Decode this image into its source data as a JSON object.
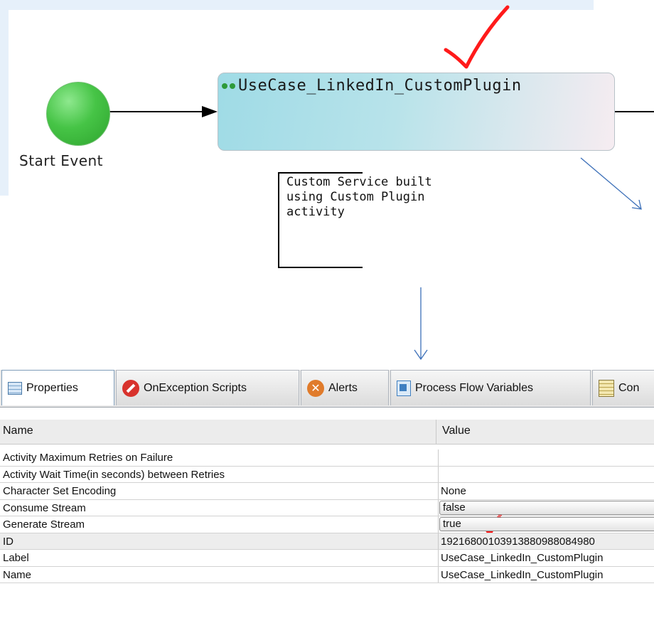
{
  "diagram": {
    "start_event_label": "Start Event",
    "task_title": "UseCase_LinkedIn_CustomPlugin",
    "annotation_lines": [
      "Custom Service built",
      "using Custom Plugin",
      "activity"
    ],
    "start_color": "#3cbf3c",
    "task_gradient_start": "#9fdbe6",
    "task_gradient_end": "#f6ecf1",
    "checkmark_color": "#ff1a1a",
    "arrow_color": "#3b6fb8"
  },
  "tabs": [
    {
      "label": "Properties",
      "icon": "properties-grid-icon",
      "active": true
    },
    {
      "label": "OnException Scripts",
      "icon": "stop-icon",
      "active": false
    },
    {
      "label": "Alerts",
      "icon": "alert-x-icon",
      "active": false
    },
    {
      "label": "Process Flow Variables",
      "icon": "process-variables-icon",
      "active": false
    },
    {
      "label": "Con",
      "icon": "list-document-icon",
      "active": false
    }
  ],
  "table": {
    "headers": {
      "name": "Name",
      "value": "Value"
    },
    "rows": [
      {
        "name": "Activity Maximum Retries on Failure",
        "value": "",
        "control": "text",
        "shaded": false
      },
      {
        "name": "Activity Wait Time(in seconds) between Retries",
        "value": "",
        "control": "text",
        "shaded": false
      },
      {
        "name": "Character Set Encoding",
        "value": "None",
        "control": "text",
        "shaded": false
      },
      {
        "name": "Consume Stream",
        "value": "false",
        "control": "combo",
        "shaded": false
      },
      {
        "name": "Generate Stream",
        "value": "true",
        "control": "combo",
        "shaded": false
      },
      {
        "name": "ID",
        "value": "19216800103913880988084980",
        "control": "text",
        "shaded": true
      },
      {
        "name": "Label",
        "value": "UseCase_LinkedIn_CustomPlugin",
        "control": "text",
        "shaded": false
      },
      {
        "name": "Name",
        "value": "UseCase_LinkedIn_CustomPlugin",
        "control": "text",
        "shaded": false
      }
    ]
  }
}
